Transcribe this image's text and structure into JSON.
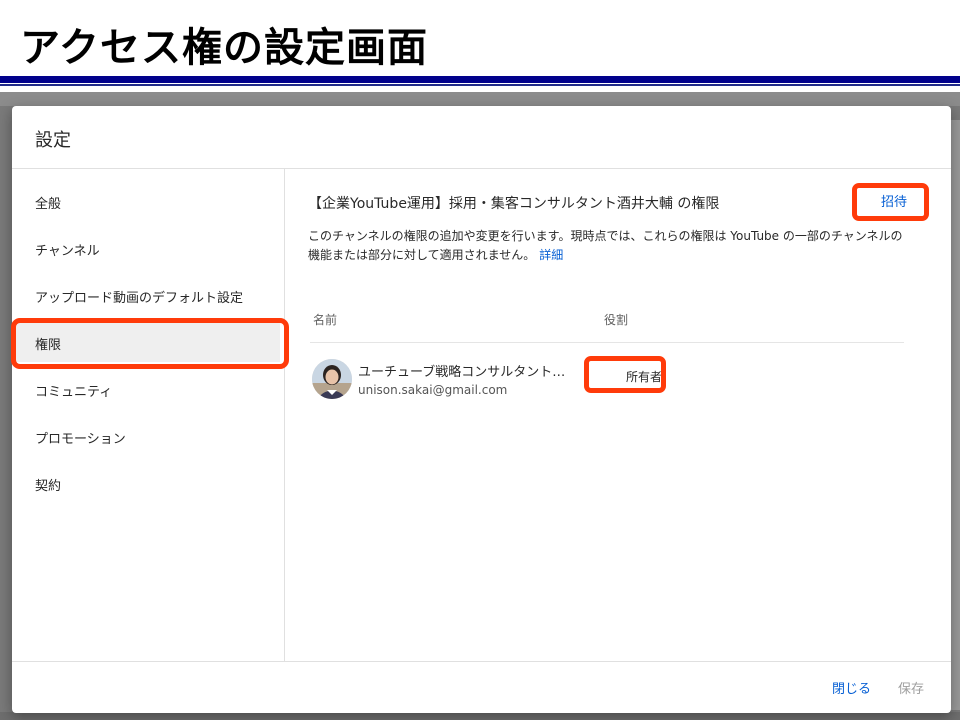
{
  "slide": {
    "title": "アクセス権の設定画面",
    "rule_color": "#00008b",
    "highlight_color": "#ff3b0a"
  },
  "dialog": {
    "title": "設定",
    "footer": {
      "close_label": "閉じる",
      "save_label": "保存"
    }
  },
  "sidebar": {
    "items": [
      {
        "label": "全般",
        "active": false
      },
      {
        "label": "チャンネル",
        "active": false
      },
      {
        "label": "アップロード動画のデフォルト設定",
        "active": false
      },
      {
        "label": "権限",
        "active": true
      },
      {
        "label": "コミュニティ",
        "active": false
      },
      {
        "label": "プロモーション",
        "active": false
      },
      {
        "label": "契約",
        "active": false
      }
    ]
  },
  "main": {
    "heading": "【企業YouTube運用】採用・集客コンサルタント酒井大輔 の権限",
    "invite_label": "招待",
    "description": "このチャンネルの権限の追加や変更を行います。現時点では、これらの権限は YouTube の一部のチャンネルの機能または部分に対して適用されません。",
    "description_link": "詳細",
    "columns": {
      "name": "名前",
      "role": "役割"
    },
    "users": [
      {
        "name": "ユーチューブ戦略コンサルタント酒…",
        "email": "unison.sakai@gmail.com",
        "role": "所有者",
        "avatar_icon": "user-avatar-photo"
      }
    ]
  },
  "colors": {
    "accent": "#065fd4",
    "active_nav_bg": "#efefef",
    "disabled_text": "#9e9e9e"
  }
}
